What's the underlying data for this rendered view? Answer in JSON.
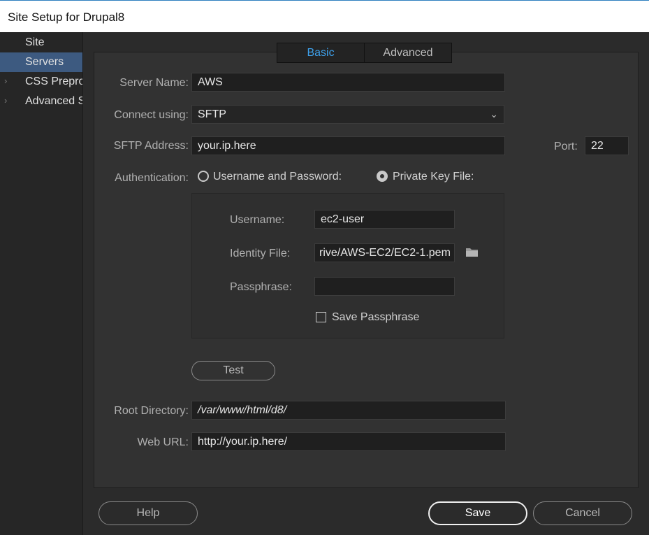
{
  "window": {
    "title": "Site Setup for Drupal8"
  },
  "sidebar": {
    "items": [
      {
        "label": "Site"
      },
      {
        "label": "Servers"
      },
      {
        "label": "CSS Preprocessors"
      },
      {
        "label": "Advanced Settings"
      }
    ]
  },
  "tabs": {
    "basic": "Basic",
    "advanced": "Advanced"
  },
  "form": {
    "server_name_label": "Server Name:",
    "server_name": "AWS",
    "connect_label": "Connect using:",
    "connect_value": "SFTP",
    "address_label": "SFTP Address:",
    "address": "your.ip.here",
    "port_label": "Port:",
    "port": "22",
    "auth_label": "Authentication:",
    "auth_userpass": "Username and Password:",
    "auth_keyfile": "Private Key File:",
    "username_label": "Username:",
    "username": "ec2-user",
    "identity_label": "Identity File:",
    "identity": "rive/AWS-EC2/EC2-1.pem",
    "passphrase_label": "Passphrase:",
    "passphrase": "",
    "save_passphrase": "Save Passphrase",
    "test_label": "Test",
    "root_label": "Root Directory:",
    "root": "/var/www/html/d8/",
    "weburl_label": "Web URL:",
    "weburl": "http://your.ip.here/"
  },
  "footer": {
    "help": "Help",
    "save": "Save",
    "cancel": "Cancel"
  },
  "colors": {
    "accent": "#3ea0ea",
    "selected_row": "#3d5a80",
    "title_border": "#2e7fbf"
  }
}
